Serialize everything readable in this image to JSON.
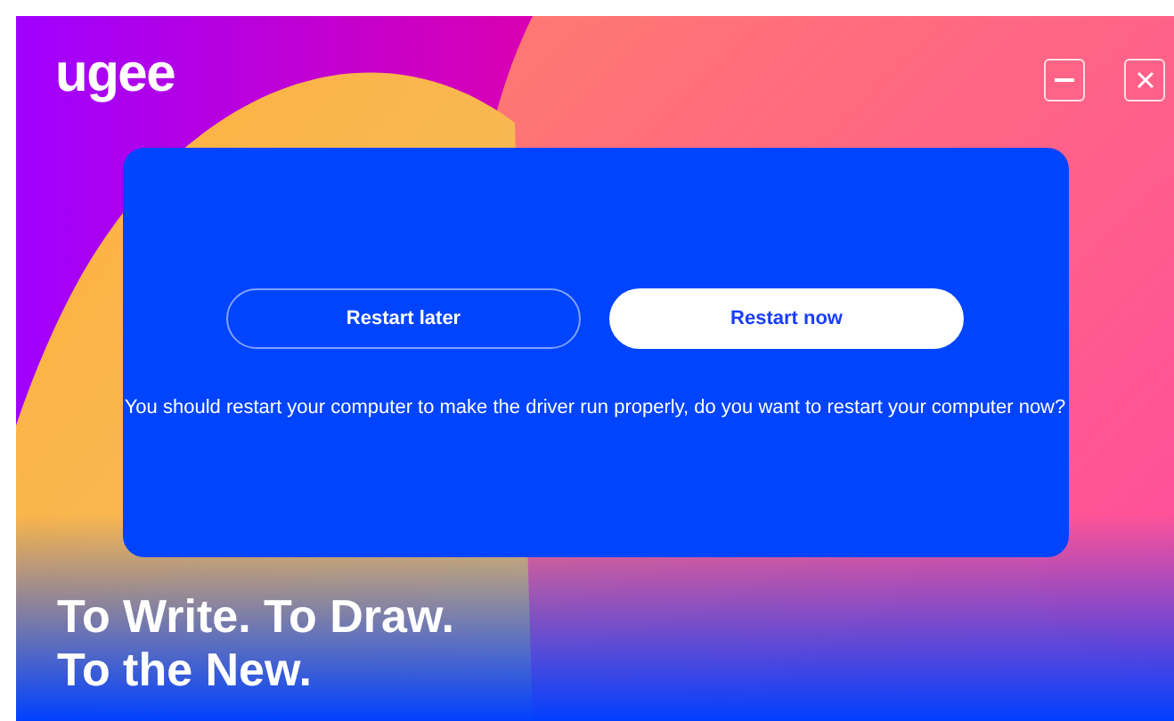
{
  "logo": "ugee",
  "window_controls": [
    {
      "kind": "minimize"
    },
    {
      "kind": "close"
    }
  ],
  "dialog": {
    "buttons": [
      {
        "label": "Restart later",
        "kind": "outline"
      },
      {
        "label": "Restart now",
        "kind": "primary"
      }
    ],
    "message": "You should restart your computer to make the driver run properly, do you want to restart your computer now?"
  },
  "tagline": [
    "To Write. To Draw.",
    "To the New."
  ]
}
